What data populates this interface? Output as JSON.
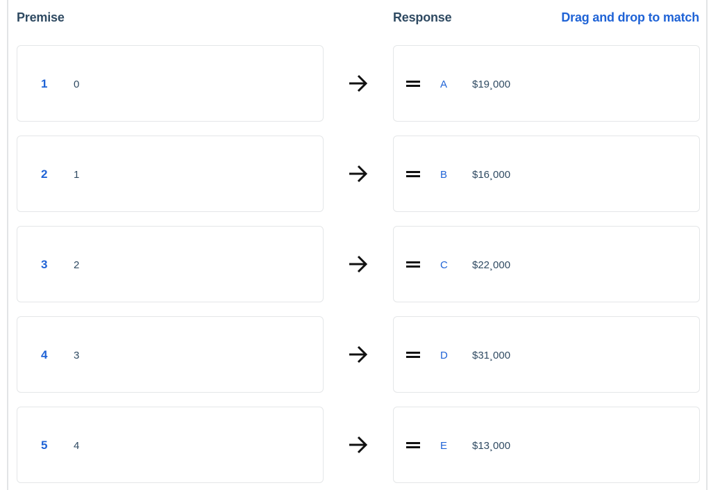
{
  "header": {
    "premise_label": "Premise",
    "response_label": "Response",
    "hint": "Drag and drop to match"
  },
  "colors": {
    "accent": "#1f63d6",
    "text": "#2f4a62",
    "border": "#e4e6e8"
  },
  "rows": [
    {
      "number": "1",
      "premise": "0",
      "arrow_icon": "arrow-right-icon",
      "handle_icon": "drag-handle-icon",
      "letter": "A",
      "response": "$19¸000"
    },
    {
      "number": "2",
      "premise": "1",
      "arrow_icon": "arrow-right-icon",
      "handle_icon": "drag-handle-icon",
      "letter": "B",
      "response": "$16¸000"
    },
    {
      "number": "3",
      "premise": "2",
      "arrow_icon": "arrow-right-icon",
      "handle_icon": "drag-handle-icon",
      "letter": "C",
      "response": "$22¸000"
    },
    {
      "number": "4",
      "premise": "3",
      "arrow_icon": "arrow-right-icon",
      "handle_icon": "drag-handle-icon",
      "letter": "D",
      "response": "$31¸000"
    },
    {
      "number": "5",
      "premise": "4",
      "arrow_icon": "arrow-right-icon",
      "handle_icon": "drag-handle-icon",
      "letter": "E",
      "response": "$13¸000"
    }
  ]
}
